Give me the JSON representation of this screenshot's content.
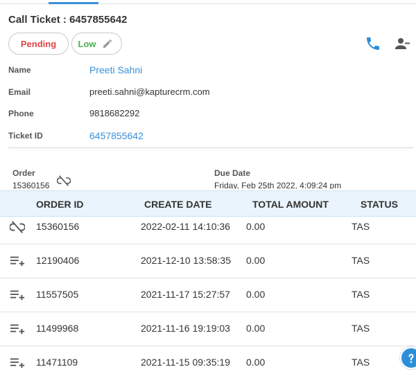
{
  "ticket": {
    "title": "Call Ticket : 6457855642",
    "status_chip": "Pending",
    "priority_chip": "Low"
  },
  "details": {
    "name_label": "Name",
    "name_value": "Preeti Sahni",
    "email_label": "Email",
    "email_value": "preeti.sahni@kapturecrm.com",
    "phone_label": "Phone",
    "phone_value": "9818682292",
    "ticket_id_label": "Ticket ID",
    "ticket_id_value": "6457855642"
  },
  "order_summary": {
    "order_label": "Order",
    "order_value": "15360156",
    "due_label": "Due Date",
    "due_value": "Friday, Feb 25th 2022, 4:09:24 pm"
  },
  "table": {
    "headers": {
      "order_id": "ORDER ID",
      "create_date": "CREATE DATE",
      "total_amount": "TOTAL AMOUNT",
      "status": "STATUS"
    },
    "rows": [
      {
        "icon": "unlink-icon",
        "order_id": "15360156",
        "create_date": "2022-02-11 14:10:36",
        "total_amount": "0.00",
        "status": "TAS"
      },
      {
        "icon": "playlist-add-icon",
        "order_id": "12190406",
        "create_date": "2021-12-10 13:58:35",
        "total_amount": "0.00",
        "status": "TAS"
      },
      {
        "icon": "playlist-add-icon",
        "order_id": "11557505",
        "create_date": "2021-11-17 15:27:57",
        "total_amount": "0.00",
        "status": "TAS"
      },
      {
        "icon": "playlist-add-icon",
        "order_id": "11499968",
        "create_date": "2021-11-16 19:19:03",
        "total_amount": "0.00",
        "status": "TAS"
      },
      {
        "icon": "playlist-add-icon",
        "order_id": "11471109",
        "create_date": "2021-11-15 09:35:19",
        "total_amount": "0.00",
        "status": "TAS"
      }
    ]
  },
  "colors": {
    "accent": "#3a8fd8",
    "pending": "#e04646",
    "low": "#4caf50",
    "table_header_bg": "#e9f4fc"
  }
}
